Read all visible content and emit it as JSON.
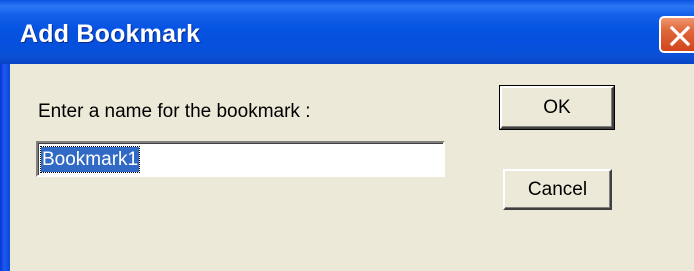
{
  "window": {
    "title": "Add Bookmark",
    "close_icon": "close-icon"
  },
  "form": {
    "prompt_label": "Enter a name for the bookmark :",
    "name_value": "Bookmark1"
  },
  "buttons": {
    "ok_label": "OK",
    "cancel_label": "Cancel"
  },
  "colors": {
    "titlebar": "#0553e1",
    "dialog_face": "#ece9d8",
    "close_button": "#d2441c",
    "selection": "#316ac5"
  }
}
